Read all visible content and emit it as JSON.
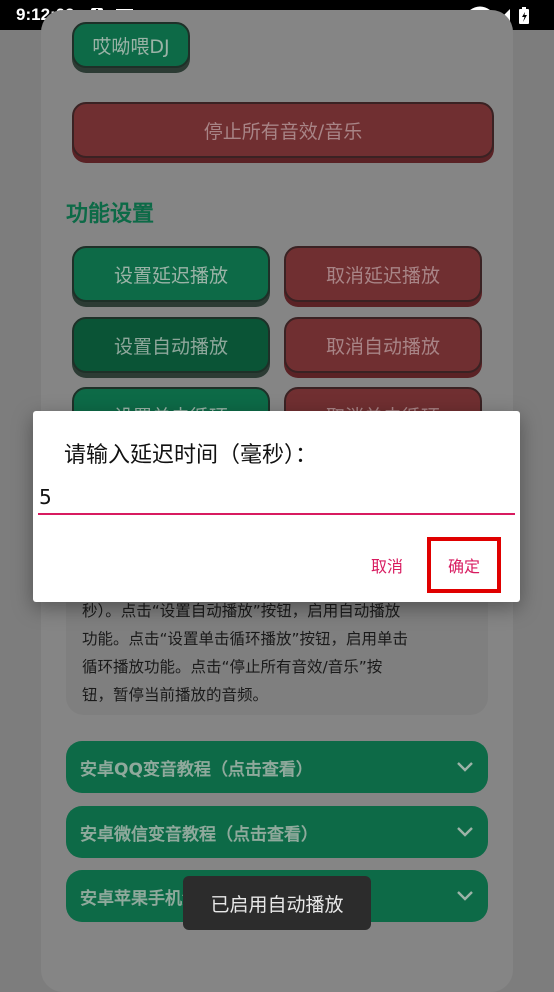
{
  "status_bar": {
    "time": "9:12:09",
    "notif_icon_letter": "A"
  },
  "app": {
    "dj_button": "哎呦喂DJ",
    "stop_all_button": "停止所有音效/音乐",
    "section_title": "功能设置",
    "set_delay_button": "设置延迟播放",
    "cancel_delay_button": "取消延迟播放",
    "set_auto_button": "设置自动播放",
    "cancel_auto_button": "取消自动播放",
    "set_loop_button": "设置单击循环",
    "cancel_loop_button": "取消单击循环",
    "info_lines": [
      "秒）。点击“设置自动播放”按钮，启用自动播放",
      "功能。点击“设置单击循环播放”按钮，启用单击",
      "循环播放功能。点击“停止所有音效/音乐”按",
      "钮，暂停当前播放的音频。"
    ],
    "accordions": [
      {
        "label": "安卓QQ变音教程（点击查看）"
      },
      {
        "label": "安卓微信变音教程（点击查看）"
      },
      {
        "label": "安卓苹果手机没声音（点击查看）"
      }
    ]
  },
  "dialog": {
    "title": "请输入延迟时间（毫秒）：",
    "input_value": "5",
    "cancel_label": "取消",
    "confirm_label": "确定",
    "accent_color": "#d81b60",
    "highlight_color": "#e00000"
  },
  "toast": {
    "text": "已启用自动播放"
  },
  "icons": {
    "notification": "a-letter-icon",
    "keyboard": "keyboard-icon",
    "wifi": "wifi-icon",
    "signal": "signal-icon",
    "battery": "battery-icon",
    "chevron": "chevron-down-icon"
  }
}
